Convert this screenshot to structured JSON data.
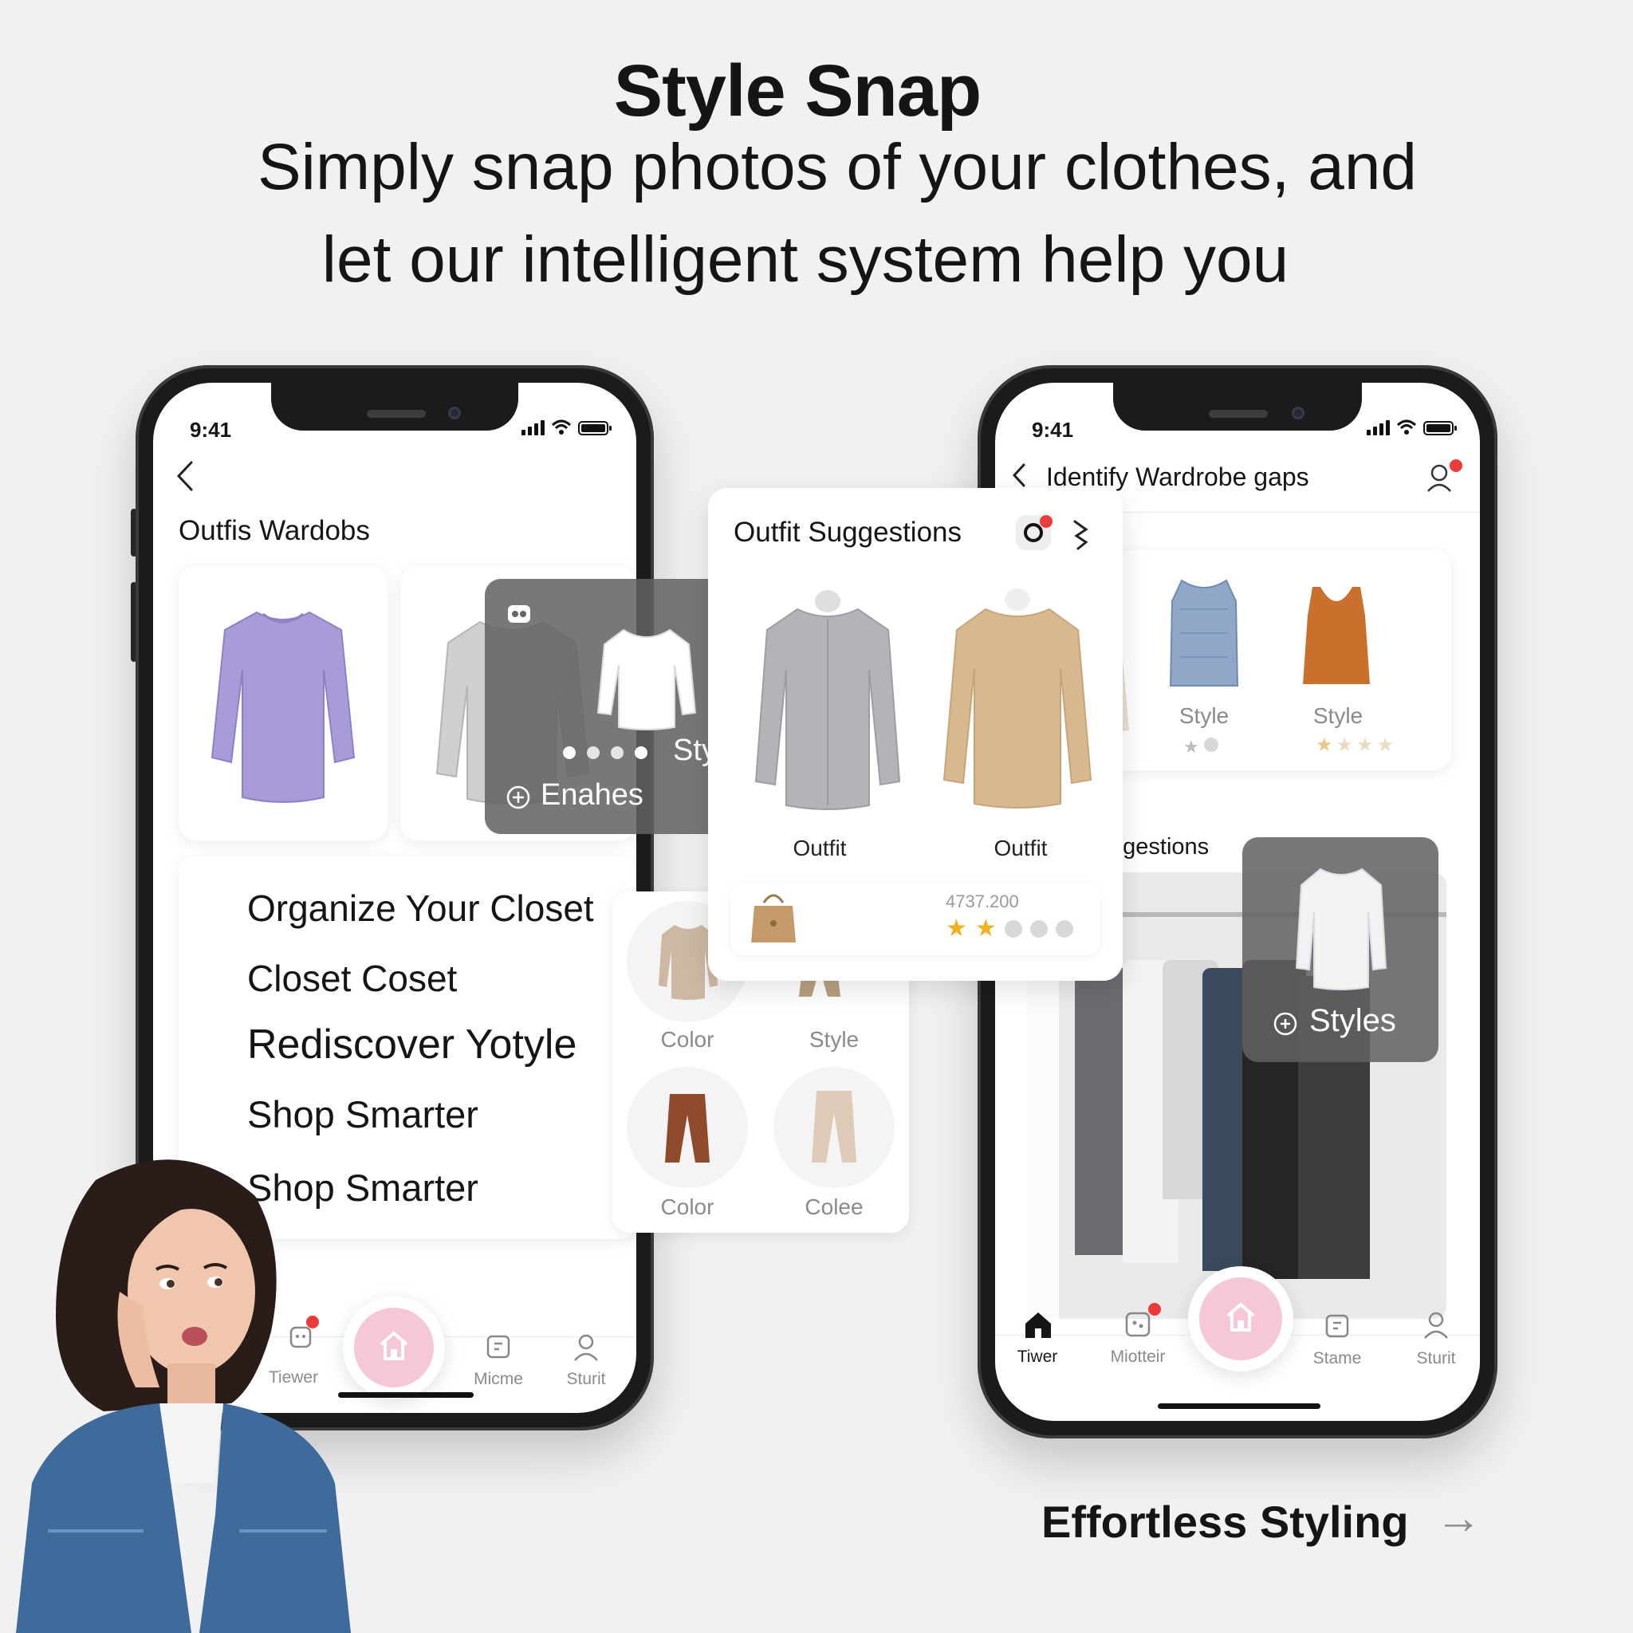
{
  "hero": {
    "title": "Style Snap",
    "subtitle_line1": "Simply snap photos of your clothes, and",
    "subtitle_line2": "let our intelligent system help you"
  },
  "left_phone": {
    "time": "9:41",
    "section_title": "Outfis Wardobs",
    "overlay_style_label": "Style",
    "overlay_enhance_label": "Enahes",
    "menu": [
      "Organize Your Closet",
      "Closet Coset",
      "Rediscover Yotyle",
      "Shop Smarter",
      "Shop Smarter"
    ],
    "nav": [
      "Tiewer",
      "Micme",
      "Sturit"
    ]
  },
  "suggestions_card": {
    "title": "Outfit Suggestions",
    "items": [
      "Outfit",
      "Outfit"
    ],
    "rating_number": "4737.200",
    "rating_filled": 2,
    "rating_total": 5
  },
  "swatch_card": {
    "labels": [
      "Color",
      "Style",
      "Color",
      "Colee"
    ]
  },
  "right_phone": {
    "time": "9:41",
    "header_title": "Identify Wardrobe gaps",
    "styles": [
      {
        "label": "Style",
        "rating": 1,
        "rating_total": 2
      },
      {
        "label": "Style",
        "rating": 1,
        "rating_total": 4
      }
    ],
    "suggestions_heading": "ggestions",
    "overlay_label": "Styles",
    "nav": [
      "Tiwer",
      "Miotteir",
      "Stame",
      "Sturit"
    ]
  },
  "footer": {
    "label": "Effortless Styling",
    "arrow": "→"
  },
  "colors": {
    "background": "#f1f1f2",
    "accent_pink": "#f6c8d7",
    "notification_red": "#ec3b3b",
    "star_gold": "#f2b01e",
    "lavender_shirt": "#a99ad8",
    "beige_sweater": "#d8b88e"
  }
}
